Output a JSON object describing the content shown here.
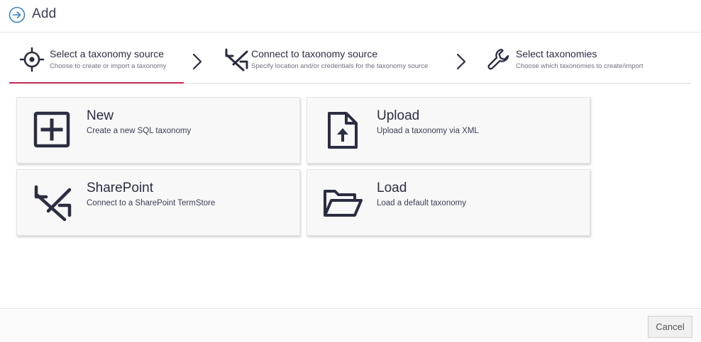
{
  "header": {
    "title": "Add",
    "icon": "arrow-right-circle-icon"
  },
  "steps": [
    {
      "title": "Select a taxonomy source",
      "subtitle": "Choose to create or import a taxonomy",
      "icon": "target-icon",
      "active": true
    },
    {
      "title": "Connect to taxonomy source",
      "subtitle": "Specify location and/or credentials for the taxonomy source",
      "icon": "swap-arrows-icon",
      "active": false
    },
    {
      "title": "Select taxonomies",
      "subtitle": "Choose which taxonomies to create/import",
      "icon": "wrench-icon",
      "active": false
    }
  ],
  "options": [
    {
      "title": "New",
      "description": "Create a new SQL taxonomy",
      "icon": "plus-square-icon"
    },
    {
      "title": "Upload",
      "description": "Upload a taxonomy via XML",
      "icon": "file-upload-icon"
    },
    {
      "title": "SharePoint",
      "description": "Connect to a SharePoint TermStore",
      "icon": "swap-arrows-icon"
    },
    {
      "title": "Load",
      "description": "Load a default taxonomy",
      "icon": "folder-open-icon"
    }
  ],
  "footer": {
    "cancel_label": "Cancel"
  },
  "colors": {
    "accent": "#c4284f",
    "icon": "#2b2d42",
    "header_icon": "#3b82c4"
  }
}
